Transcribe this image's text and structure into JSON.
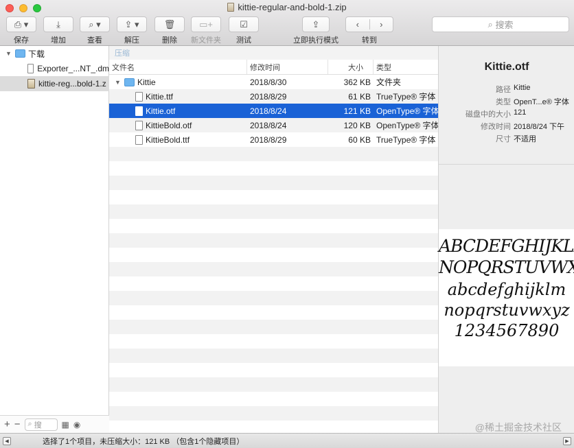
{
  "window": {
    "title": "kittie-regular-and-bold-1.zip"
  },
  "toolbar": {
    "save": "保存",
    "add": "增加",
    "view": "查看",
    "extract": "解压",
    "delete": "删除",
    "new_folder": "新文件夹",
    "test": "测试",
    "run_now": "立即执行模式",
    "goto": "转到",
    "search_placeholder": "搜索"
  },
  "sidebar": {
    "root": "下载",
    "items": [
      {
        "label": "Exporter_...NT_.dm",
        "selected": false
      },
      {
        "label": "kittie-reg...bold-1.z",
        "selected": true
      }
    ],
    "search_placeholder": "搜"
  },
  "path_bar": "压缩",
  "columns": {
    "name": "文件名",
    "modified": "修改时间",
    "size": "大小",
    "type": "类型"
  },
  "rows": [
    {
      "name": "Kittie",
      "modified": "2018/8/30",
      "size": "362 KB",
      "type": "文件夹",
      "kind": "folder",
      "indent": 0,
      "selected": false
    },
    {
      "name": "Kittie.ttf",
      "modified": "2018/8/29",
      "size": "61 KB",
      "type": "TrueType® 字体",
      "kind": "file",
      "indent": 1,
      "selected": false
    },
    {
      "name": "Kittie.otf",
      "modified": "2018/8/24",
      "size": "121 KB",
      "type": "OpenType® 字体",
      "kind": "file",
      "indent": 1,
      "selected": true
    },
    {
      "name": "KittieBold.otf",
      "modified": "2018/8/24",
      "size": "120 KB",
      "type": "OpenType® 字体",
      "kind": "file",
      "indent": 1,
      "selected": false
    },
    {
      "name": "KittieBold.ttf",
      "modified": "2018/8/29",
      "size": "60 KB",
      "type": "TrueType® 字体",
      "kind": "file",
      "indent": 1,
      "selected": false
    }
  ],
  "preview": {
    "title": "Kittie.otf",
    "meta": [
      {
        "k": "路径",
        "v": "Kittie"
      },
      {
        "k": "类型",
        "v": "OpenT...e® 字体"
      },
      {
        "k": "磁盘中的大小",
        "v": "121"
      },
      {
        "k": "修改时间",
        "v": "2018/8/24 下午"
      },
      {
        "k": "尺寸",
        "v": "不适用"
      }
    ],
    "sample": [
      "ABCDEFGHIJKLM",
      "NOPQRSTUVWXYZ",
      "abcdefghijklm",
      "nopqrstuvwxyz",
      "1234567890"
    ]
  },
  "status": {
    "text": "选择了1个项目，未压缩大小：121 KB （包含1个隐藏项目）"
  },
  "watermark": "@稀土掘金技术社区",
  "colors": {
    "selection": "#1a62d6",
    "folder": "#6fb6f0"
  }
}
